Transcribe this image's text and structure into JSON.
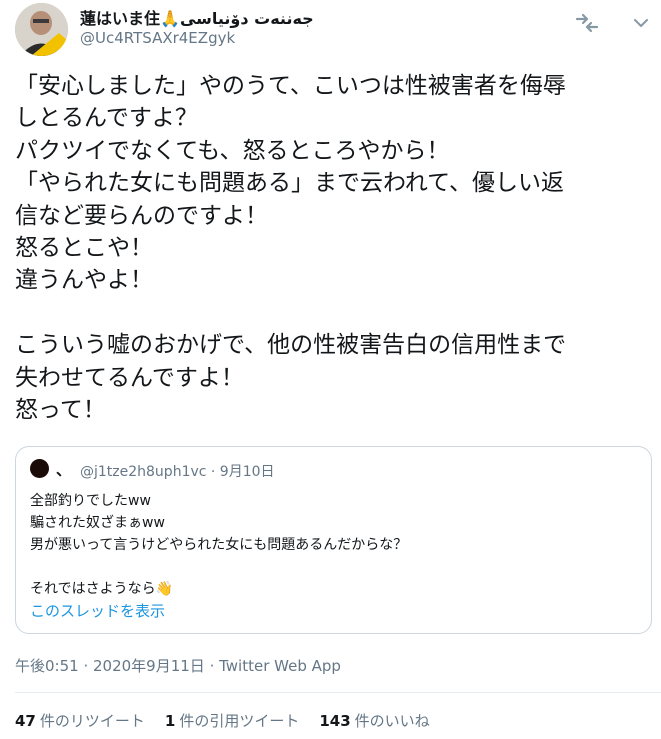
{
  "author": {
    "display_name": "蓮はいま住🙏جەننەت دۆنیاسی",
    "handle": "@Uc4RTSAXr4EZgyk"
  },
  "header_icons": [
    "retweet-alt-icon",
    "chevron-down-icon"
  ],
  "body_lines": [
    "「安心しました」やのうて、こいつは性被害者を侮辱",
    "しとるんですよ？",
    "パクツイでなくても、怒るところやから！",
    "「やられた女にも問題ある」まで云われて、優しい返",
    "信など要らんのですよ！",
    "怒るとこや！",
    "違うんやよ！",
    "",
    "こういう嘘のおかげで、他の性被害告白の信用性まで",
    "失わせてるんですよ！",
    "怒って！"
  ],
  "quoted_tweet": {
    "name": "、",
    "handle_date": "@j1tze2h8uph1vc · 9月10日",
    "lines": [
      "全部釣りでしたww",
      "騙された奴ざまぁww",
      "男が悪いって言うけどやられた女にも問題あるんだからな？",
      "",
      "それではさようなら👋"
    ],
    "thread_link": "このスレッドを表示"
  },
  "meta": {
    "timestamp": "午後0:51 · 2020年9月11日",
    "separator": " · ",
    "app": "Twitter Web App"
  },
  "stats": {
    "retweets": {
      "count": "47",
      "label": "件のリツイート"
    },
    "quotes": {
      "count": "1",
      "label": "件の引用ツイート"
    },
    "likes": {
      "count": "143",
      "label": "件のいいね"
    }
  },
  "colors": {
    "text": "#14171a",
    "secondary": "#657786",
    "link": "#1b95e0",
    "border": "#ccd6dd"
  }
}
